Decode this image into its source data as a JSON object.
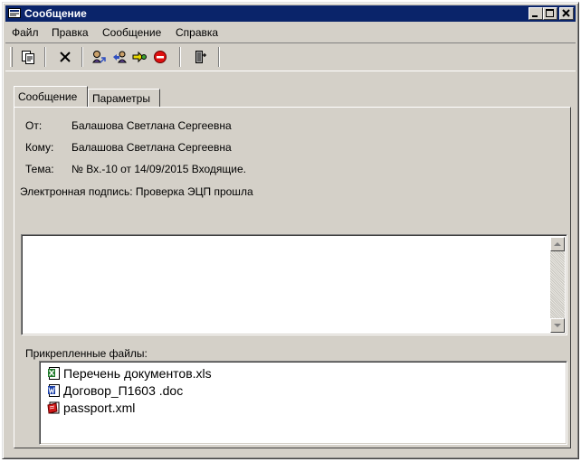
{
  "window": {
    "title": "Сообщение"
  },
  "menu": [
    {
      "label": "Файл"
    },
    {
      "label": "Правка"
    },
    {
      "label": "Сообщение"
    },
    {
      "label": "Справка"
    }
  ],
  "toolbar": {
    "buttons": [
      {
        "icon": "copy-document-icon"
      },
      {
        "icon": "delete-x-icon"
      },
      {
        "icon": "reply-icon"
      },
      {
        "icon": "reply-all-icon"
      },
      {
        "icon": "forward-icon"
      },
      {
        "icon": "stop-icon"
      },
      {
        "icon": "exit-door-icon"
      }
    ]
  },
  "tabs": [
    {
      "label": "Сообщение",
      "active": true
    },
    {
      "label": "Параметры",
      "active": false
    }
  ],
  "message": {
    "from_label": "От:",
    "from_value": "Балашова Светлана Сергеевна",
    "to_label": "Кому:",
    "to_value": "Балашова Светлана Сергеевна",
    "subject_label": "Тема:",
    "subject_value": "№ Вх.-10 от 14/09/2015 Входящие.",
    "signature": "Электронная подпись: Проверка ЭЦП прошла",
    "body": ""
  },
  "attachments": {
    "label": "Прикрепленные файлы:",
    "files": [
      {
        "name": "Перечень документов.xls",
        "icon": "excel-file-icon"
      },
      {
        "name": "Договор_П1603 .doc",
        "icon": "word-file-icon"
      },
      {
        "name": "passport.xml",
        "icon": "xml-file-icon"
      }
    ]
  },
  "colors": {
    "titlebar": "#0a246a",
    "chrome": "#d4d0c8"
  }
}
